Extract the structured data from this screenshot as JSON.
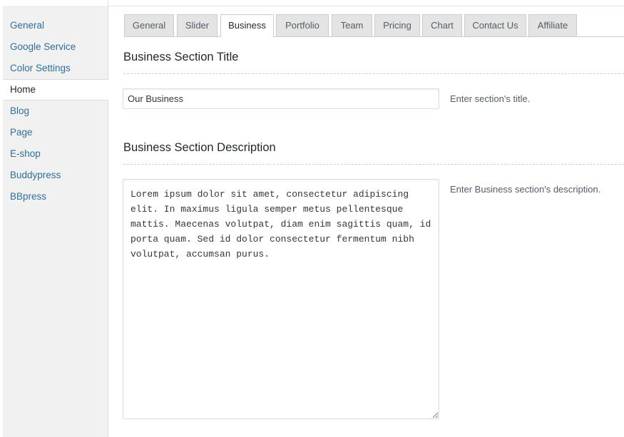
{
  "sidebar": {
    "items": [
      {
        "label": "General"
      },
      {
        "label": "Google Service"
      },
      {
        "label": "Color Settings"
      },
      {
        "label": "Home",
        "active": true
      },
      {
        "label": "Blog"
      },
      {
        "label": "Page"
      },
      {
        "label": "E-shop"
      },
      {
        "label": "Buddypress"
      },
      {
        "label": "BBpress"
      }
    ]
  },
  "tabs": [
    {
      "label": "General"
    },
    {
      "label": "Slider"
    },
    {
      "label": "Business",
      "active": true
    },
    {
      "label": "Portfolio"
    },
    {
      "label": "Team"
    },
    {
      "label": "Pricing"
    },
    {
      "label": "Chart"
    },
    {
      "label": "Contact Us"
    },
    {
      "label": "Affiliate"
    }
  ],
  "business_title": {
    "heading": "Business Section Title",
    "value": "Our Business",
    "help": "Enter section's title."
  },
  "business_description": {
    "heading": "Business Section Description",
    "value": "Lorem ipsum dolor sit amet, consectetur adipiscing elit. In maximus ligula semper metus pellentesque mattis. Maecenas volutpat, diam enim sagittis quam, id porta quam. Sed id dolor consectetur fermentum nibh volutpat, accumsan purus.",
    "help": "Enter Business section's description."
  },
  "colors": {
    "link": "#2e6f9a",
    "sidebar_bg": "#f1f1f1",
    "tab_bg": "#e4e4e4"
  }
}
